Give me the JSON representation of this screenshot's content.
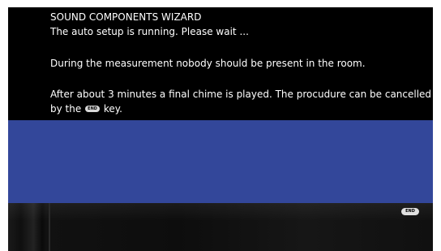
{
  "wizard": {
    "title": "SOUND COMPONENTS WIZARD",
    "line1": "The auto setup is running. Please wait ...",
    "line2": "During the measurement nobody should be present in the room.",
    "line3": "After about 3 minutes a final chime is played. The procudure can be cancelled",
    "line4_prefix": "by the",
    "line4_key": "END",
    "line4_suffix": "key."
  },
  "bottom_bar": {
    "end_key_label": "END"
  },
  "colors": {
    "panel_background": "#000000",
    "band_blue": "#33479a",
    "text": "#ffffff"
  }
}
